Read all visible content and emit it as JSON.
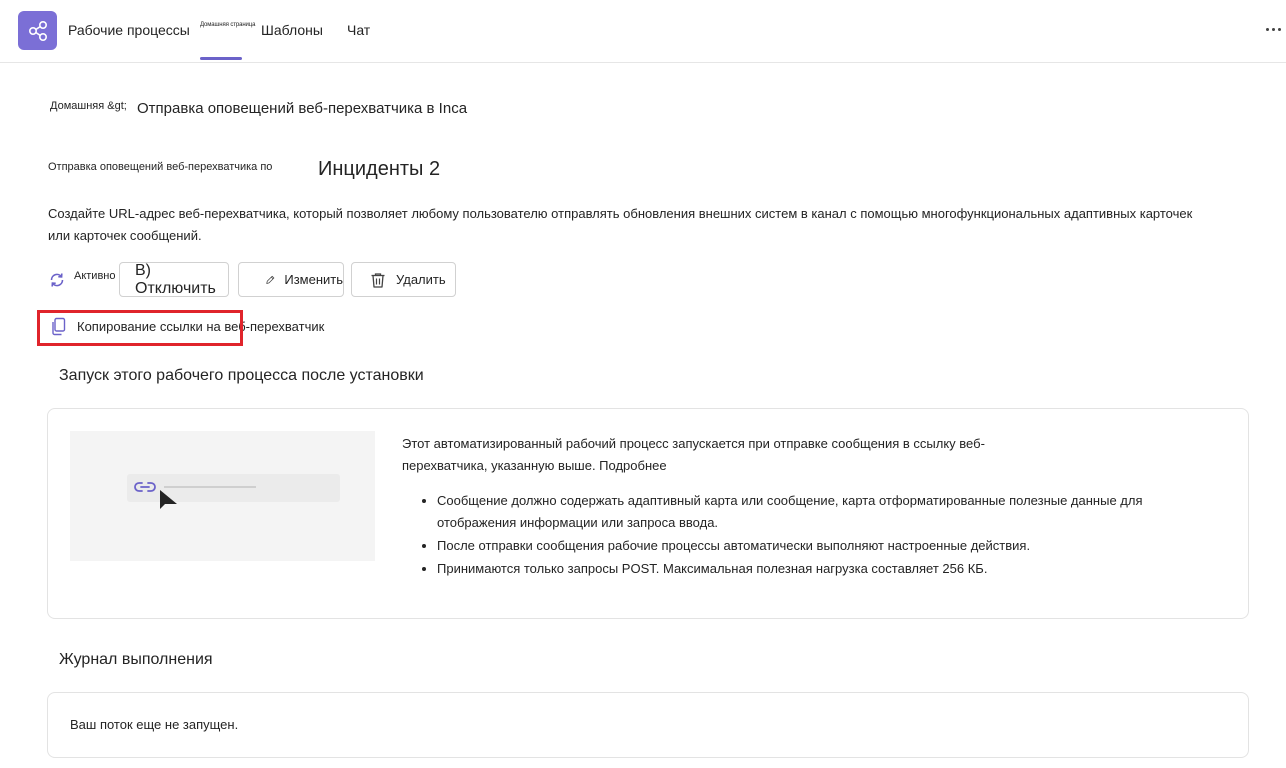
{
  "header": {
    "app_title": "Рабочие процессы",
    "tabs": [
      {
        "label": "Домашняя страница"
      },
      {
        "label": "Шаблоны"
      },
      {
        "label": "Чат"
      }
    ],
    "more_icon": "more-horizontal-icon",
    "app_icon": "share-nodes-icon",
    "accent": "#7b6fd6"
  },
  "breadcrumb": {
    "home": "Домашняя &gt;",
    "current": "Отправка оповещений веб-перехватчика в Inca"
  },
  "workflow": {
    "subtitle": "Отправка оповещений веб-перехватчика по",
    "team": "Инциденты 2",
    "description": "Создайте URL-адрес веб-перехватчика, который позволяет любому пользователю отправлять обновления внешних систем в канал с помощью многофункциональных адаптивных карточек или карточек сообщений."
  },
  "actions": {
    "status": "Активно",
    "disable": "В) Отключить",
    "edit": "Изменить",
    "delete": "Удалить",
    "copy_link": "Копирование ссылки на веб-перехватчик"
  },
  "run_section": {
    "title": "Запуск этого рабочего процесса после установки",
    "info": "Этот автоматизированный рабочий процесс запускается при отправке сообщения в ссылку веб-перехватчика, указанную выше. Подробнее",
    "bullets": [
      "Сообщение должно содержать адаптивный карта или сообщение, карта отформатированные полезные данные для отображения информации или запроса ввода.",
      "После отправки сообщения рабочие процессы автоматически выполняют настроенные действия.",
      "Принимаются только запросы POST. Максимальная полезная нагрузка составляет 256 КБ."
    ]
  },
  "log_section": {
    "title": "Журнал выполнения",
    "empty": "Ваш поток еще не запущен."
  },
  "highlight_color": "#e0242b"
}
